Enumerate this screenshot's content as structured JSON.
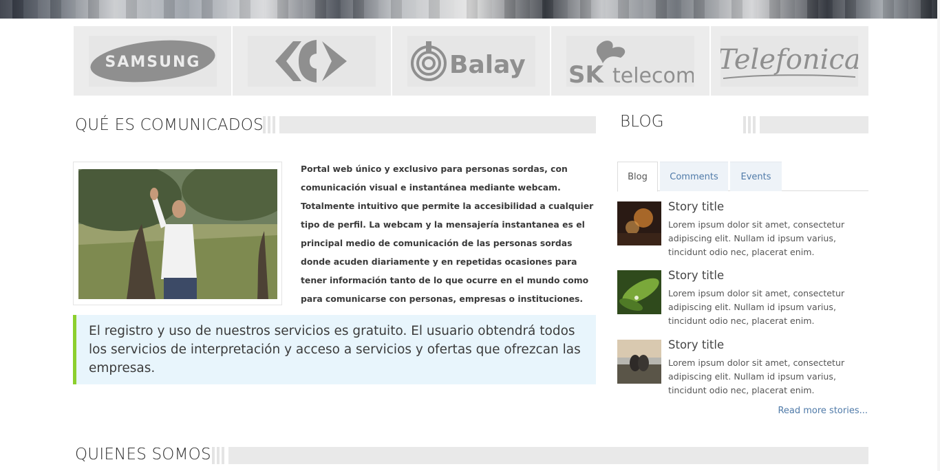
{
  "sponsors": {
    "items": [
      {
        "name": "SAMSUNG",
        "icon": "samsung-logo"
      },
      {
        "name": "Carrefour",
        "icon": "carrefour-logo"
      },
      {
        "name": "Balay",
        "icon": "balay-logo"
      },
      {
        "name": "SK telecom",
        "icon": "sk-telecom-logo"
      },
      {
        "name": "Telefonica",
        "icon": "telefonica-logo"
      }
    ],
    "background_color": "#ececec",
    "logo_color": "#8f8f8f"
  },
  "about": {
    "title": "QUÉ ES COMUNICADOS",
    "intro": "Portal web único y exclusivo para personas sordas, con comunicación visual e instantánea mediante webcam. Totalmente intuitivo que permite la accesibilidad a cualquier tipo de perfil. La webcam y la mensajería instantanea es el principal medio de comunicación de las personas sordas donde acuden diariamente y en repetidas ocasiones para tener información tanto de lo que ocurre en el mundo como para comunicarse con personas, empresas o instituciones.",
    "callout": "El registro y uso de nuestros servicios es gratuito. El usuario obtendrá todos los servicios de interpretación y acceso a servicios y ofertas que ofrezcan las empresas.",
    "callout_bg": "#e8f5fc",
    "callout_accent": "#8ccf2d"
  },
  "blog": {
    "title": "BLOG",
    "tabs": [
      "Blog",
      "Comments",
      "Events"
    ],
    "active_tab": "Blog",
    "stories": [
      {
        "title": "Story title",
        "text": "Lorem ipsum dolor sit amet, consectetur adipiscing elit. Nullam id ipsum varius, tincidunt odio nec, placerat enim.",
        "thumb": "concert-photo"
      },
      {
        "title": "Story title",
        "text": "Lorem ipsum dolor sit amet, consectetur adipiscing elit. Nullam id ipsum varius, tincidunt odio nec, placerat enim.",
        "thumb": "leaf-photo"
      },
      {
        "title": "Story title",
        "text": "Lorem ipsum dolor sit amet, consectetur adipiscing elit. Nullam id ipsum varius, tincidunt odio nec, placerat enim.",
        "thumb": "couple-photo"
      }
    ],
    "read_more": "Read more stories...",
    "link_color": "#4f7aa8"
  },
  "team": {
    "title": "QUIENES SOMOS"
  }
}
